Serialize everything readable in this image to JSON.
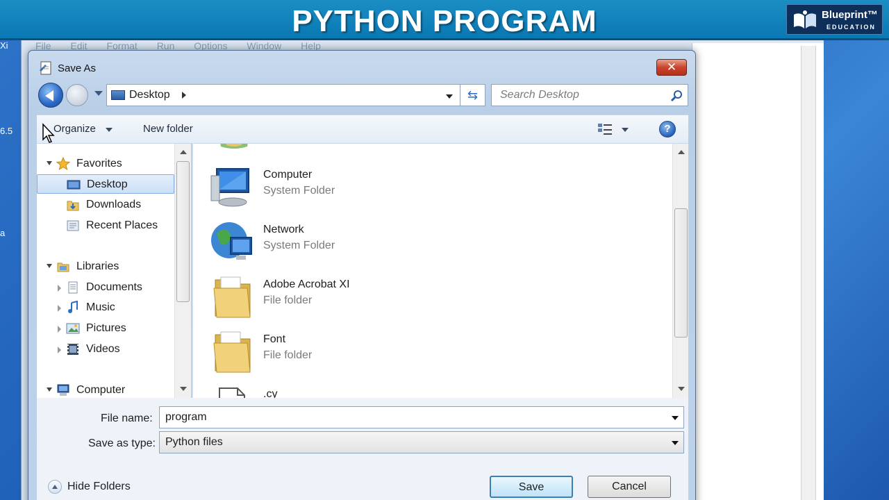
{
  "banner": {
    "title": "PYTHON PROGRAM",
    "logo_name": "Blueprint™",
    "logo_sub": "EDUCATION"
  },
  "background_window": {
    "menu": "File Edit Format Run Options Window Help"
  },
  "desktop_fragments": [
    "Xi",
    "6.5",
    "a"
  ],
  "dialog": {
    "title": "Save As",
    "address": {
      "location": "Desktop"
    },
    "search": {
      "placeholder": "Search Desktop"
    },
    "toolbar": {
      "organize": "Organize",
      "new_folder": "New folder"
    },
    "nav": [
      {
        "label": "Favorites",
        "icon": "star-icon",
        "twisty": "open",
        "selected": false
      },
      {
        "label": "Desktop",
        "icon": "desktop-icon",
        "twisty": "none",
        "selected": true
      },
      {
        "label": "Downloads",
        "icon": "downloads-icon",
        "twisty": "none",
        "selected": false
      },
      {
        "label": "Recent Places",
        "icon": "recent-places-icon",
        "twisty": "none",
        "selected": false
      },
      {
        "label": "Libraries",
        "icon": "libraries-icon",
        "twisty": "open",
        "selected": false
      },
      {
        "label": "Documents",
        "icon": "documents-icon",
        "twisty": "closed",
        "selected": false
      },
      {
        "label": "Music",
        "icon": "music-icon",
        "twisty": "closed",
        "selected": false
      },
      {
        "label": "Pictures",
        "icon": "pictures-icon",
        "twisty": "closed",
        "selected": false
      },
      {
        "label": "Videos",
        "icon": "videos-icon",
        "twisty": "closed",
        "selected": false
      },
      {
        "label": "Computer",
        "icon": "computer-icon",
        "twisty": "open",
        "selected": false
      }
    ],
    "files": [
      {
        "name": "Computer",
        "type": "System Folder",
        "icon": "computer-icon"
      },
      {
        "name": "Network",
        "type": "System Folder",
        "icon": "network-icon"
      },
      {
        "name": "Adobe Acrobat XI",
        "type": "File folder",
        "icon": "folder-icon"
      },
      {
        "name": "Font",
        "type": "File folder",
        "icon": "folder-icon"
      },
      {
        "name": ".cy",
        "type": "",
        "icon": "file-icon"
      }
    ],
    "form": {
      "file_name_label": "File name:",
      "file_name_value": "program",
      "save_type_label": "Save as type:",
      "save_type_value": "Python files"
    },
    "hide_folders": "Hide Folders",
    "save_button": "Save",
    "cancel_button": "Cancel"
  }
}
